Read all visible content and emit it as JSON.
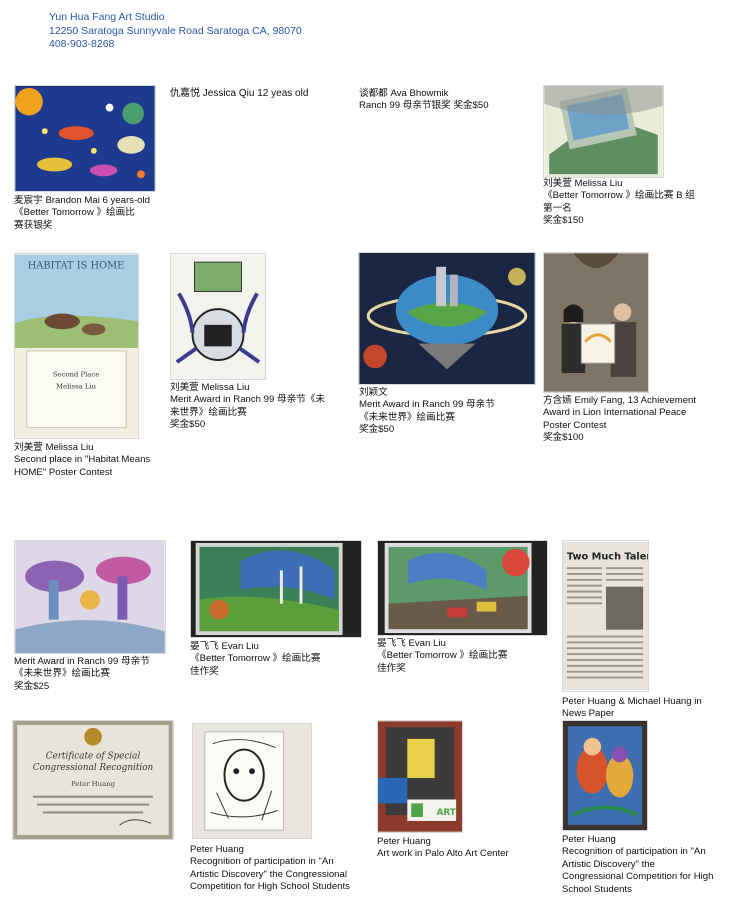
{
  "header": {
    "studio_name": "Yun Hua Fang Art Studio",
    "address": "12250 Saratoga Sunnyvale Road Saratoga CA, 98070",
    "phone": "408-903-8268"
  },
  "entries": [
    {
      "caption": "麦宸宇 Brandon Mai 6 years-old\n《Better Tomorrow 》绘画比\n赛获银奖"
    },
    {
      "caption": "仇嘉悦 Jessica Qiu 12 yeas old"
    },
    {
      "caption": "谈都都 Ava Bhowmik\nRanch 99 母亲节银奖  奖金$50"
    },
    {
      "caption": "刘美萱 Melissa Liu\n《Better Tomorrow 》绘画比赛 B 组\n第一名\n奖金$150"
    },
    {
      "caption": "刘美萱 Melissa Liu\nSecond place in \"Habitat Means\nHOME\" Poster Contest"
    },
    {
      "caption": "刘美萱 Melissa Liu\nMerit Award in Ranch 99 母亲节《未\n来世界》绘画比赛\n奖金$50"
    },
    {
      "caption": "刘颖文\nMerit Award in Ranch 99 母亲节\n《未来世界》绘画比赛\n奖金$50"
    },
    {
      "caption": "方含嫣 Emily Fang, 13  Achievement\nAward in Lion International Peace\nPoster Contest\n 奖金$100"
    },
    {
      "caption": "Merit Award in Ranch 99 母亲节\n《未来世界》绘画比赛\n奖金$25"
    },
    {
      "caption": "晏飞飞 Evan Liu\n《Better Tomorrow 》绘画比赛\n佳作奖"
    },
    {
      "caption": "晏飞飞 Evan Liu\n《Better Tomorrow 》绘画比赛\n佳作奖"
    },
    {
      "caption": "Peter Huang & Michael Huang in\nNews Paper"
    },
    {
      "caption": "Peter Huang\nRecognition of participation in \"An\nArtistic Discovery\" the Congressional\nCompetition for High School Students"
    },
    {
      "caption": "Peter Huang\nArt work in Palo Alto Art Center"
    },
    {
      "caption": "Peter Huang\nRecognition of participation in \"An\nArtistic Discovery\" the\nCongressional Competition for High\nSchool Students"
    }
  ],
  "poster_text": {
    "habitat_title": "HABITAT IS HOME",
    "habitat_place": "Second Place",
    "habitat_name": "Melissa Liu",
    "newspaper_headline": "Two Much Talent",
    "certificate_title": "Certificate of Special",
    "certificate_subtitle": "Congressional Recognition",
    "certificate_name": "Peter Huang",
    "sign_text": "ART"
  },
  "colors": {
    "header_blue": "#2a58a8"
  }
}
